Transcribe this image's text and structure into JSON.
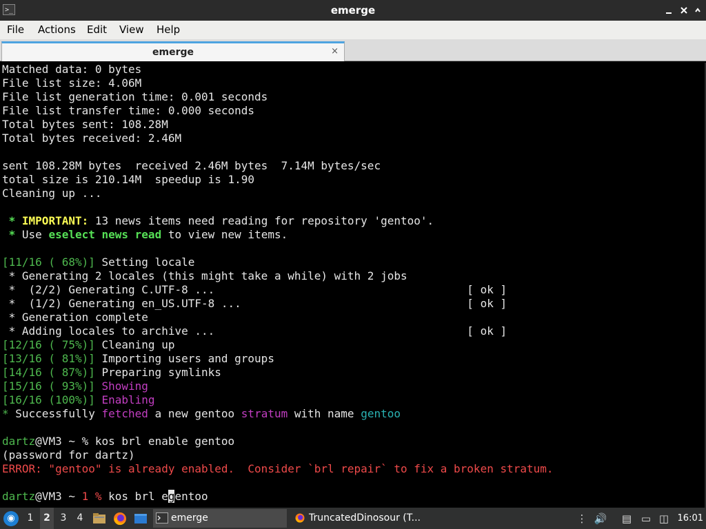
{
  "window": {
    "title": "emerge",
    "icon": "terminal-icon"
  },
  "menu": [
    "File",
    "Actions",
    "Edit",
    "View",
    "Help"
  ],
  "tab": {
    "label": "emerge",
    "close": "×"
  },
  "terminal": {
    "lines": [
      [
        {
          "t": "Matched data: 0 bytes"
        }
      ],
      [
        {
          "t": "File list size: 4.06M"
        }
      ],
      [
        {
          "t": "File list generation time: 0.001 seconds"
        }
      ],
      [
        {
          "t": "File list transfer time: 0.000 seconds"
        }
      ],
      [
        {
          "t": "Total bytes sent: 108.28M"
        }
      ],
      [
        {
          "t": "Total bytes received: 2.46M"
        }
      ],
      [],
      [
        {
          "t": "sent 108.28M bytes  received 2.46M bytes  7.14M bytes/sec"
        }
      ],
      [
        {
          "t": "total size is 210.14M  speedup is 1.90"
        }
      ],
      [
        {
          "t": "Cleaning up ..."
        }
      ],
      [],
      [
        {
          "t": " * ",
          "c": "gb"
        },
        {
          "t": "IMPORTANT:",
          "c": "yb"
        },
        {
          "t": " 13 news items need reading for repository 'gentoo'."
        }
      ],
      [
        {
          "t": " * ",
          "c": "gb"
        },
        {
          "t": "Use "
        },
        {
          "t": "eselect news read",
          "c": "gb"
        },
        {
          "t": " to view new items."
        }
      ],
      [],
      [
        {
          "t": "[11/16 ( 68%)]",
          "c": "g"
        },
        {
          "t": " Setting locale"
        }
      ],
      [
        {
          "t": " * Generating 2 locales (this might take a while) with 2 jobs"
        }
      ],
      [
        {
          "t": " *  (2/2) Generating C.UTF-8 ...                                      [ ok ]"
        }
      ],
      [
        {
          "t": " *  (1/2) Generating en_US.UTF-8 ...                                  [ ok ]"
        }
      ],
      [
        {
          "t": " * Generation complete"
        }
      ],
      [
        {
          "t": " * Adding locales to archive ...                                      [ ok ]"
        }
      ],
      [
        {
          "t": "[12/16 ( 75%)]",
          "c": "g"
        },
        {
          "t": " Cleaning up"
        }
      ],
      [
        {
          "t": "[13/16 ( 81%)]",
          "c": "g"
        },
        {
          "t": " Importing users and groups"
        }
      ],
      [
        {
          "t": "[14/16 ( 87%)]",
          "c": "g"
        },
        {
          "t": " Preparing symlinks"
        }
      ],
      [
        {
          "t": "[15/16 ( 93%)]",
          "c": "g"
        },
        {
          "t": " Showing",
          "c": "m"
        }
      ],
      [
        {
          "t": "[16/16 (100%)]",
          "c": "g"
        },
        {
          "t": " Enabling",
          "c": "m"
        }
      ],
      [
        {
          "t": "*",
          "c": "g"
        },
        {
          "t": " Successfully "
        },
        {
          "t": "fetched",
          "c": "m"
        },
        {
          "t": " a new gentoo "
        },
        {
          "t": "stratum",
          "c": "m"
        },
        {
          "t": " with name "
        },
        {
          "t": "gentoo",
          "c": "c"
        }
      ],
      [],
      [
        {
          "t": "dartz",
          "c": "g"
        },
        {
          "t": "@VM3 ~ % kos brl enable gentoo"
        }
      ],
      [
        {
          "t": "(password for dartz)"
        }
      ],
      [
        {
          "t": "ERROR: \"gentoo\" is already enabled.  Consider `brl repair` to fix a broken stratum.",
          "c": "r"
        }
      ],
      [],
      [
        {
          "t": "dartz",
          "c": "g"
        },
        {
          "t": "@VM3 ~ "
        },
        {
          "t": "1 %",
          "c": "r"
        },
        {
          "t": " kos brl e"
        },
        {
          "t": "g",
          "c": "cursor"
        },
        {
          "t": "entoo"
        }
      ]
    ]
  },
  "taskbar": {
    "workspaces": [
      "1",
      "2",
      "3",
      "4"
    ],
    "active_workspace": "2",
    "tasks": [
      {
        "label": "emerge",
        "icon": "terminal-icon",
        "active": true
      },
      {
        "label": "TruncatedDinosour (T...",
        "icon": "firefox-icon",
        "active": false
      }
    ],
    "clock": "16:01"
  }
}
